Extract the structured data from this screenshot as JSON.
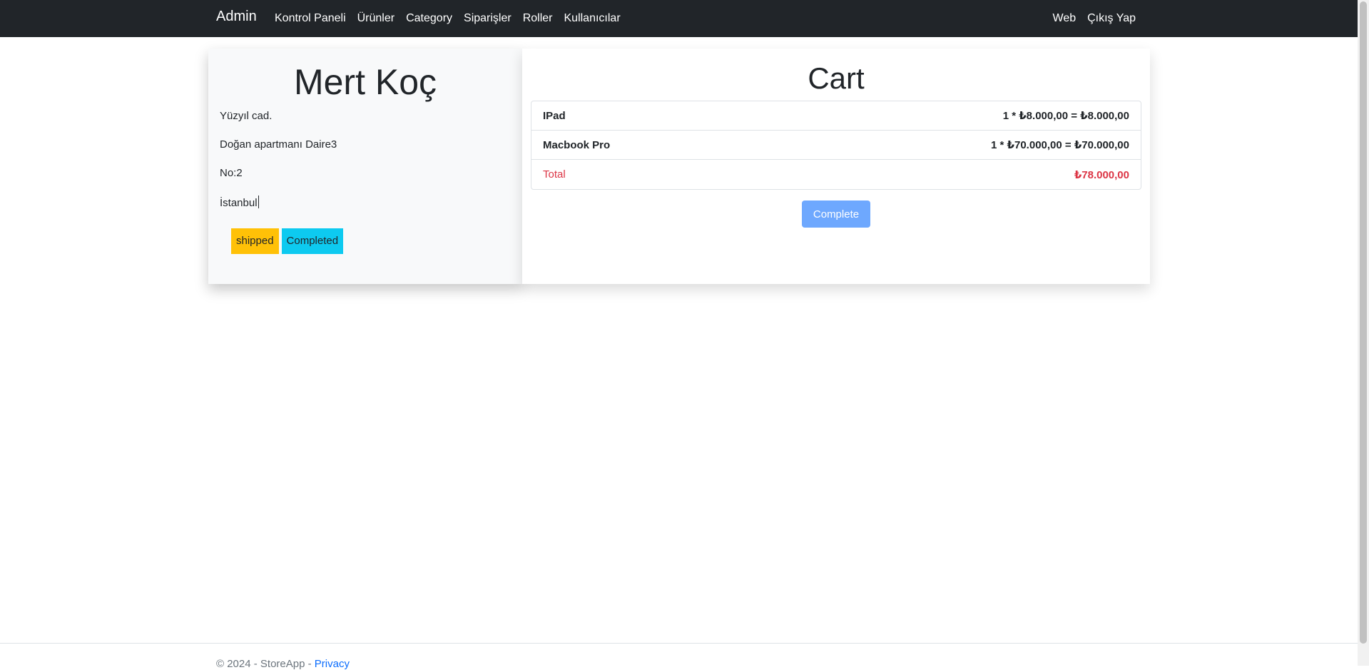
{
  "navbar": {
    "brand": "Admin",
    "left_links": [
      "Kontrol Paneli",
      "Ürünler",
      "Category",
      "Siparişler",
      "Roller",
      "Kullanıcılar"
    ],
    "right_links": [
      "Web",
      "Çıkış Yap"
    ]
  },
  "customer": {
    "name": "Mert Koç",
    "address_lines": [
      "Yüzyıl cad.",
      "Doğan apartmanı Daire3",
      "No:2",
      "İstanbul"
    ],
    "badges": {
      "shipped": "shipped",
      "completed": "Completed"
    }
  },
  "cart": {
    "title": "Cart",
    "items": [
      {
        "name": "IPad",
        "price": "1 * ₺8.000,00 = ₺8.000,00"
      },
      {
        "name": "Macbook Pro",
        "price": "1 * ₺70.000,00 = ₺70.000,00"
      }
    ],
    "total_label": "Total",
    "total_value": "₺78.000,00",
    "complete_button": "Complete"
  },
  "footer": {
    "copyright": "© 2024 - StoreApp - ",
    "privacy": "Privacy"
  },
  "colors": {
    "navbar_bg": "#212529",
    "shipped_badge": "#ffc107",
    "completed_badge": "#0dcaf0",
    "total_text": "#dc3545",
    "complete_button": "#6ea8fe"
  }
}
